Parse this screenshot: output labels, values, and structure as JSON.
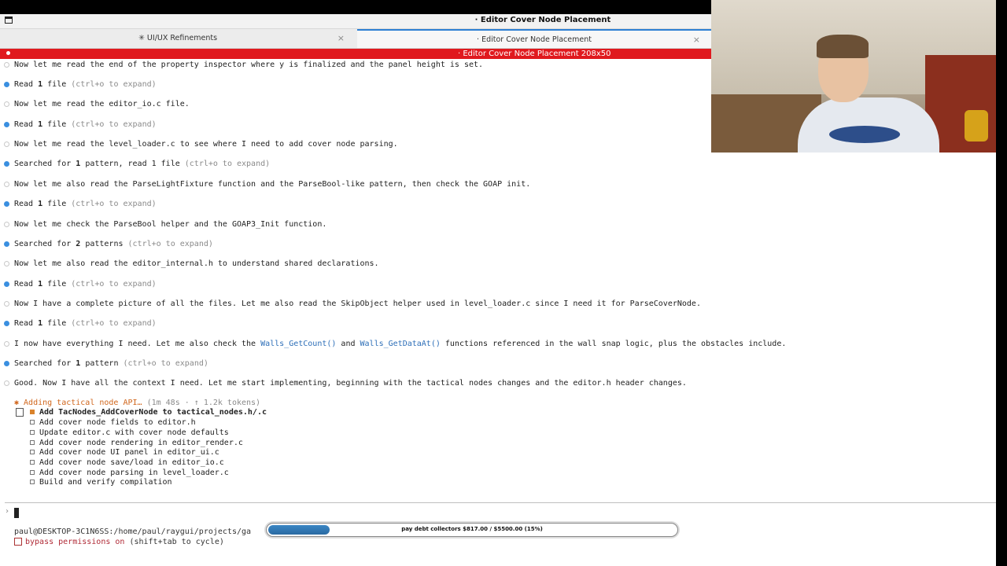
{
  "window": {
    "title": "· Editor Cover Node Placement"
  },
  "tabs": [
    {
      "label": "✳ UI/UX Refinements",
      "close": "×"
    },
    {
      "label": "· Editor Cover Node Placement",
      "close": "×"
    }
  ],
  "terminal_banner": "· Editor Cover Node Placement 208x50",
  "transcript": [
    {
      "bullet": "white",
      "text": "Now let me read the end of the property inspector where y is finalized and the panel height is set."
    },
    {
      "bullet": "blue",
      "pre": "Read ",
      "bold": "1",
      "post": " file",
      "hint": " (ctrl+o to expand)"
    },
    {
      "bullet": "white",
      "text": "Now let me read the editor_io.c file."
    },
    {
      "bullet": "blue",
      "pre": "Read ",
      "bold": "1",
      "post": " file",
      "hint": " (ctrl+o to expand)"
    },
    {
      "bullet": "white",
      "text": "Now let me read the level_loader.c to see where I need to add cover node parsing."
    },
    {
      "bullet": "blue",
      "pre": "Searched for ",
      "bold": "1",
      "post": " pattern, read 1 file",
      "hint": " (ctrl+o to expand)"
    },
    {
      "bullet": "white",
      "text": "Now let me also read the ParseLightFixture function and the ParseBool-like pattern, then check the GOAP init."
    },
    {
      "bullet": "blue",
      "pre": "Read ",
      "bold": "1",
      "post": " file",
      "hint": " (ctrl+o to expand)"
    },
    {
      "bullet": "white",
      "text": "Now let me check the ParseBool helper and the GOAP3_Init function."
    },
    {
      "bullet": "blue",
      "pre": "Searched for ",
      "bold": "2",
      "post": " patterns",
      "hint": " (ctrl+o to expand)"
    },
    {
      "bullet": "white",
      "text": "Now let me also read the editor_internal.h to understand shared declarations."
    },
    {
      "bullet": "blue",
      "pre": "Read ",
      "bold": "1",
      "post": " file",
      "hint": " (ctrl+o to expand)"
    },
    {
      "bullet": "white",
      "text": "Now I have a complete picture of all the files. Let me also read the SkipObject helper used in level_loader.c since I need it for ParseCoverNode."
    },
    {
      "bullet": "blue",
      "pre": "Read ",
      "bold": "1",
      "post": " file",
      "hint": " (ctrl+o to expand)"
    },
    {
      "bullet": "white",
      "segments": [
        "I now have everything I need. Let me also check the ",
        "Walls_GetCount()",
        " and ",
        "Walls_GetDataAt()",
        " functions referenced in the wall snap logic, plus the obstacles include."
      ]
    },
    {
      "bullet": "blue",
      "pre": "Searched for ",
      "bold": "1",
      "post": " pattern",
      "hint": " (ctrl+o to expand)"
    },
    {
      "bullet": "white",
      "text": "Good. Now I have all the context I need. Let me start implementing, beginning with the tactical nodes changes and the editor.h header changes."
    }
  ],
  "activity": {
    "label": "✱ Adding tactical node API…",
    "meta": " (1m 48s · ↑ 1.2k tokens)"
  },
  "tasks": [
    {
      "label": "Add TacNodes_AddCoverNode to tactical_nodes.h/.c",
      "current": true
    },
    {
      "label": "Add cover node fields to editor.h",
      "current": false
    },
    {
      "label": "Update editor.c with cover node defaults",
      "current": false
    },
    {
      "label": "Add cover node rendering in editor_render.c",
      "current": false
    },
    {
      "label": "Add cover node UI panel in editor_ui.c",
      "current": false
    },
    {
      "label": "Add cover node save/load in editor_io.c",
      "current": false
    },
    {
      "label": "Add cover node parsing in level_loader.c",
      "current": false
    },
    {
      "label": "Build and verify compilation",
      "current": false
    }
  ],
  "prompt": {
    "chevron": "›"
  },
  "status": {
    "path": "paul@DESKTOP-3C1N6SS:/home/paul/raygui/projects/ga",
    "bypass_label": "bypass permissions on",
    "bypass_hint": " (shift+tab to cycle)"
  },
  "progress": {
    "text": "pay debt collectors $817.00 / $5500.00 (15%)",
    "fraction": 0.15,
    "color": "#2a6aa2"
  },
  "colors": {
    "banner": "#e0191e",
    "bullet_blue": "#3a8fe0",
    "accent_orange": "#d0661c",
    "function_blue": "#2e6fb8"
  }
}
